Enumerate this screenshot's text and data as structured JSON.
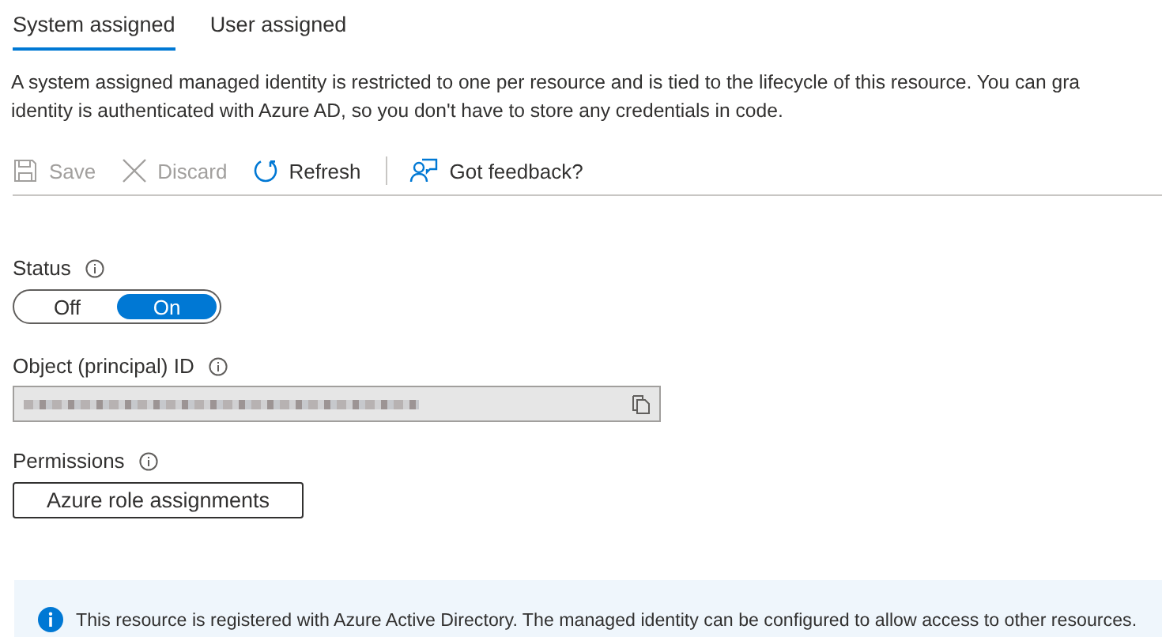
{
  "tabs": [
    {
      "label": "System assigned",
      "selected": true
    },
    {
      "label": "User assigned",
      "selected": false
    }
  ],
  "description": [
    "A system assigned managed identity is restricted to one per resource and is tied to the lifecycle of this resource. You can gra",
    "identity is authenticated with Azure AD, so you don't have to store any credentials in code."
  ],
  "toolbar": [
    {
      "kind": "save",
      "label": "Save",
      "disabled": true
    },
    {
      "kind": "discard",
      "label": "Discard",
      "disabled": true
    },
    {
      "kind": "refresh",
      "label": "Refresh",
      "disabled": false
    },
    {
      "kind": "divider"
    },
    {
      "kind": "feedback",
      "label": "Got feedback?",
      "disabled": false
    }
  ],
  "status": {
    "label": "Status",
    "options": [
      {
        "label": "Off",
        "selected": false
      },
      {
        "label": "On",
        "selected": true
      }
    ]
  },
  "object_id": {
    "label": "Object (principal) ID"
  },
  "permissions": {
    "label": "Permissions",
    "button": "Azure role assignments"
  },
  "info_bar": {
    "text": "This resource is registered with Azure Active Directory. The managed identity can be configured to allow access to other resources."
  }
}
